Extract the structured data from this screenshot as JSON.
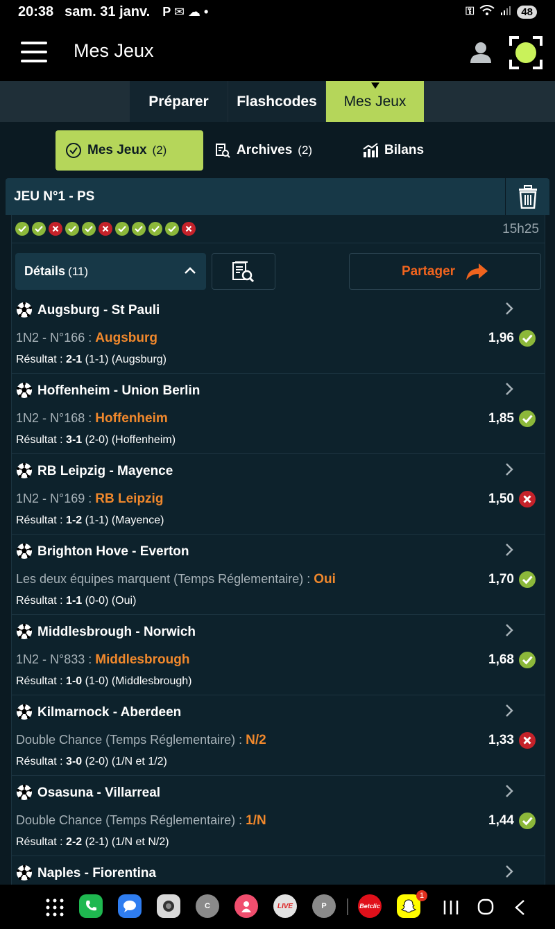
{
  "status_bar": {
    "time": "20:38",
    "date": "sam. 31 janv.",
    "notifications": "P ✉ ☁ •",
    "battery": "48"
  },
  "app_bar": {
    "title": "Mes Jeux"
  },
  "top_tabs": [
    {
      "label": "Préparer",
      "active": false
    },
    {
      "label": "Flashcodes",
      "active": false
    },
    {
      "label": "Mes Jeux",
      "active": true
    }
  ],
  "sub_tabs": [
    {
      "label": "Mes Jeux",
      "count": "(2)",
      "active": true
    },
    {
      "label": "Archives",
      "count": "(2)",
      "active": false
    },
    {
      "label": "Bilans",
      "count": "",
      "active": false
    }
  ],
  "bet": {
    "title": "JEU N°1  - PS",
    "time": "15h25",
    "outcomes": [
      "ok",
      "ok",
      "ko",
      "ok",
      "ok",
      "ko",
      "ok",
      "ok",
      "ok",
      "ok",
      "ko"
    ],
    "details_label": "Détails",
    "details_count": "(11)",
    "share_label": "Partager"
  },
  "matches": [
    {
      "teams": "Augsburg - St Pauli",
      "market": "1N2 - N°166 :",
      "pick": "Augsburg",
      "odds": "1,96",
      "status": "ok",
      "res_label": "Résultat :",
      "score": "2-1",
      "res_detail": "(1-1) (Augsburg)"
    },
    {
      "teams": "Hoffenheim - Union Berlin",
      "market": "1N2 - N°168 :",
      "pick": "Hoffenheim",
      "odds": "1,85",
      "status": "ok",
      "res_label": "Résultat :",
      "score": "3-1",
      "res_detail": "(2-0) (Hoffenheim)"
    },
    {
      "teams": "RB Leipzig - Mayence",
      "market": "1N2 - N°169 :",
      "pick": "RB Leipzig",
      "odds": "1,50",
      "status": "ko",
      "res_label": "Résultat :",
      "score": "1-2",
      "res_detail": "(1-1) (Mayence)"
    },
    {
      "teams": "Brighton Hove - Everton",
      "market": "Les deux équipes marquent (Temps Réglementaire) :",
      "pick": "Oui",
      "odds": "1,70",
      "status": "ok",
      "res_label": "Résultat :",
      "score": "1-1",
      "res_detail": "(0-0) (Oui)"
    },
    {
      "teams": "Middlesbrough - Norwich",
      "market": "1N2 - N°833 :",
      "pick": "Middlesbrough",
      "odds": "1,68",
      "status": "ok",
      "res_label": "Résultat :",
      "score": "1-0",
      "res_detail": "(1-0) (Middlesbrough)"
    },
    {
      "teams": "Kilmarnock - Aberdeen",
      "market": "Double Chance (Temps Réglementaire) :",
      "pick": "N/2",
      "odds": "1,33",
      "status": "ko",
      "res_label": "Résultat :",
      "score": "3-0",
      "res_detail": "(2-0) (1/N et 1/2)"
    },
    {
      "teams": "Osasuna - Villarreal",
      "market": "Double Chance (Temps Réglementaire) :",
      "pick": "1/N",
      "odds": "1,44",
      "status": "ok",
      "res_label": "Résultat :",
      "score": "2-2",
      "res_detail": "(2-1) (1/N et N/2)"
    },
    {
      "teams": "Naples - Fiorentina",
      "market": "",
      "pick": "",
      "odds": "",
      "status": "",
      "res_label": "",
      "score": "",
      "res_detail": ""
    }
  ],
  "nav_apps": [
    {
      "name": "apps-grid",
      "label": ""
    },
    {
      "name": "phone",
      "label": ""
    },
    {
      "name": "messages",
      "label": ""
    },
    {
      "name": "camera",
      "label": ""
    },
    {
      "name": "chrome-c",
      "label": "C"
    },
    {
      "name": "app-pink",
      "label": ""
    },
    {
      "name": "live",
      "label": "LIVE"
    },
    {
      "name": "chrome-p",
      "label": "P"
    },
    {
      "name": "betclic",
      "label": "Betclic"
    },
    {
      "name": "snapchat",
      "label": "",
      "badge": "1"
    }
  ],
  "colors": {
    "accent": "#b5d65a",
    "pick": "#f0882c",
    "ok": "#8cb83a",
    "ko": "#c5222a",
    "share": "#f0641e"
  }
}
